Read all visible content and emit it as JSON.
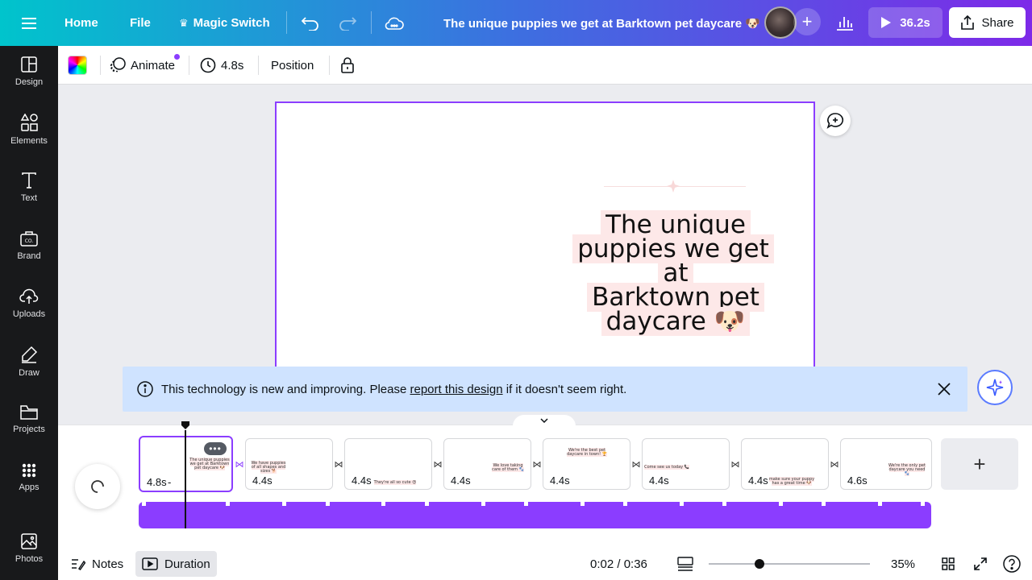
{
  "topbar": {
    "home": "Home",
    "file": "File",
    "magic_switch": "Magic Switch",
    "title": "The unique puppies we get at Barktown pet daycare 🐶",
    "play_duration": "36.2s",
    "share": "Share"
  },
  "sidebar": {
    "items": [
      {
        "label": "Design",
        "icon": "design-icon"
      },
      {
        "label": "Elements",
        "icon": "elements-icon"
      },
      {
        "label": "Text",
        "icon": "text-icon"
      },
      {
        "label": "Brand",
        "icon": "brand-icon"
      },
      {
        "label": "Uploads",
        "icon": "uploads-icon"
      },
      {
        "label": "Draw",
        "icon": "draw-icon"
      },
      {
        "label": "Projects",
        "icon": "projects-icon"
      },
      {
        "label": "Apps",
        "icon": "apps-icon"
      },
      {
        "label": "Photos",
        "icon": "photos-icon"
      }
    ]
  },
  "toolbar": {
    "animate": "Animate",
    "duration": "4.8s",
    "position": "Position"
  },
  "canvas": {
    "headline_line1": "The unique",
    "headline_line2": "puppies we get at",
    "headline_line3": "Barktown pet",
    "headline_line4": "daycare 🐶"
  },
  "notice": {
    "prefix": "This technology is new and improving. Please ",
    "link": "report this design",
    "suffix": " if it doesn't seem right."
  },
  "timeline": {
    "pages": [
      {
        "duration": "4.8s",
        "text": "The unique puppies we get at Barktown pet daycare 🐶"
      },
      {
        "duration": "4.4s",
        "text": "We have puppies of all shapes and sizes 🐕"
      },
      {
        "duration": "4.4s",
        "text": "They're all so cute 😍"
      },
      {
        "duration": "4.4s",
        "text": "We love taking care of them 🐾"
      },
      {
        "duration": "4.4s",
        "text": "We're the best pet daycare in town! 🏆"
      },
      {
        "duration": "4.4s",
        "text": "Come see us today 📞"
      },
      {
        "duration": "4.4s",
        "text": "make sure your puppy has a great time 🐶"
      },
      {
        "duration": "4.6s",
        "text": "We're the only pet daycare you need 🐾"
      }
    ]
  },
  "bottombar": {
    "notes": "Notes",
    "duration": "Duration",
    "time": "0:02 / 0:36",
    "zoom": "35%"
  },
  "colors": {
    "accent": "#8b3dff",
    "sidebar_bg": "#18191b",
    "notice_bg": "#cfe3ff",
    "highlight": "#fde8e8"
  }
}
